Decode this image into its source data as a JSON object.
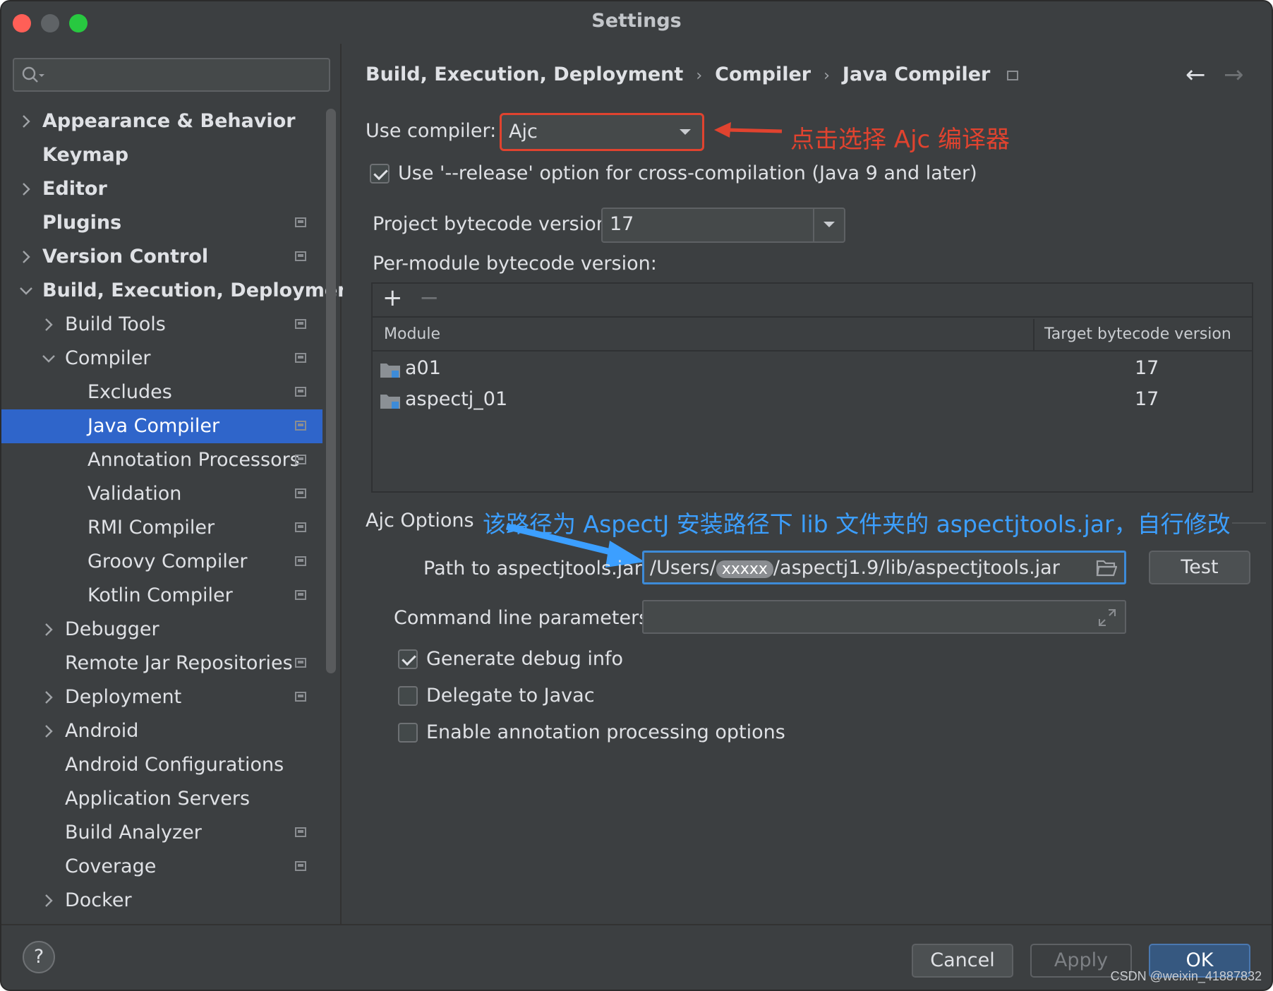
{
  "window": {
    "title": "Settings",
    "traffic_lights": [
      "#ff5f57",
      "#5f6366",
      "#28c840"
    ]
  },
  "sidebar": {
    "search_placeholder": "",
    "items": [
      {
        "label": "Appearance & Behavior",
        "chevron": "right",
        "bold": true,
        "level": 0,
        "proj": false
      },
      {
        "label": "Keymap",
        "chevron": "",
        "bold": true,
        "level": 0,
        "proj": false
      },
      {
        "label": "Editor",
        "chevron": "right",
        "bold": true,
        "level": 0,
        "proj": false
      },
      {
        "label": "Plugins",
        "chevron": "",
        "bold": true,
        "level": 0,
        "proj": true
      },
      {
        "label": "Version Control",
        "chevron": "right",
        "bold": true,
        "level": 0,
        "proj": true
      },
      {
        "label": "Build, Execution, Deployment",
        "chevron": "down",
        "bold": true,
        "level": 0,
        "proj": false
      },
      {
        "label": "Build Tools",
        "chevron": "right",
        "bold": false,
        "level": 1,
        "proj": true
      },
      {
        "label": "Compiler",
        "chevron": "down",
        "bold": false,
        "level": 1,
        "proj": true
      },
      {
        "label": "Excludes",
        "chevron": "",
        "bold": false,
        "level": 2,
        "proj": true
      },
      {
        "label": "Java Compiler",
        "chevron": "",
        "bold": false,
        "level": 2,
        "proj": true,
        "selected": true
      },
      {
        "label": "Annotation Processors",
        "chevron": "",
        "bold": false,
        "level": 2,
        "proj": true
      },
      {
        "label": "Validation",
        "chevron": "",
        "bold": false,
        "level": 2,
        "proj": true
      },
      {
        "label": "RMI Compiler",
        "chevron": "",
        "bold": false,
        "level": 2,
        "proj": true
      },
      {
        "label": "Groovy Compiler",
        "chevron": "",
        "bold": false,
        "level": 2,
        "proj": true
      },
      {
        "label": "Kotlin Compiler",
        "chevron": "",
        "bold": false,
        "level": 2,
        "proj": true
      },
      {
        "label": "Debugger",
        "chevron": "right",
        "bold": false,
        "level": 1,
        "proj": false
      },
      {
        "label": "Remote Jar Repositories",
        "chevron": "",
        "bold": false,
        "level": 1,
        "proj": true
      },
      {
        "label": "Deployment",
        "chevron": "right",
        "bold": false,
        "level": 1,
        "proj": true
      },
      {
        "label": "Android",
        "chevron": "right",
        "bold": false,
        "level": 1,
        "proj": false
      },
      {
        "label": "Android Configurations",
        "chevron": "",
        "bold": false,
        "level": 1,
        "proj": false
      },
      {
        "label": "Application Servers",
        "chevron": "",
        "bold": false,
        "level": 1,
        "proj": false
      },
      {
        "label": "Build Analyzer",
        "chevron": "",
        "bold": false,
        "level": 1,
        "proj": true
      },
      {
        "label": "Coverage",
        "chevron": "",
        "bold": false,
        "level": 1,
        "proj": true
      },
      {
        "label": "Docker",
        "chevron": "right",
        "bold": false,
        "level": 1,
        "proj": false
      }
    ]
  },
  "breadcrumb": {
    "part1": "Build, Execution, Deployment",
    "part2": "Compiler",
    "part3": "Java Compiler",
    "separator": "›"
  },
  "nav": {
    "back": "←",
    "forward": "→"
  },
  "compiler": {
    "use_compiler_label": "Use compiler:",
    "use_compiler_value": "Ajc",
    "release_option_label": "Use '--release' option for cross-compilation (Java 9 and later)",
    "release_option_checked": true,
    "project_bytecode_label": "Project bytecode version:",
    "project_bytecode_value": "17",
    "per_module_label": "Per-module bytecode version:"
  },
  "module_table": {
    "add": "+",
    "remove": "−",
    "columns": [
      "Module",
      "Target bytecode version"
    ],
    "rows": [
      {
        "module": "a01",
        "version": "17"
      },
      {
        "module": "aspectj_01",
        "version": "17"
      }
    ]
  },
  "ajc_options": {
    "section_label": "Ajc Options",
    "path_label": "Path to aspectjtools.jar:",
    "path_value_prefix": "/Users/",
    "path_value_mask": "xxxxx",
    "path_value_suffix": "/aspectj1.9/lib/aspectjtools.jar",
    "test_button": "Test",
    "cmd_label": "Command line parameters:",
    "cmd_value": "",
    "generate_debug_label": "Generate debug info",
    "generate_debug_checked": true,
    "delegate_label": "Delegate to Javac",
    "delegate_checked": false,
    "annotation_label": "Enable annotation processing options",
    "annotation_checked": false
  },
  "annotations": {
    "red_note": "点击选择 Ajc 编译器",
    "blue_note": "该路径为 AspectJ 安装路径下 lib 文件夹的 aspectjtools.jar，自行修改",
    "red_color": "#e0432f",
    "blue_color": "#3c9fff"
  },
  "footer": {
    "help": "?",
    "cancel": "Cancel",
    "apply": "Apply",
    "ok": "OK"
  },
  "watermark": "CSDN @weixin_41887832",
  "colors": {
    "background": "#3c3f41",
    "selection": "#2f65ca",
    "ok_button": "#365880",
    "focus_border": "#3d8bd8"
  }
}
